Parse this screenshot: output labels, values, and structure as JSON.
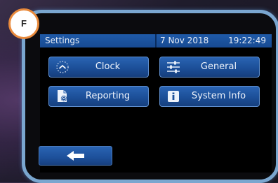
{
  "badge": {
    "label": "F"
  },
  "header": {
    "title": "Settings",
    "date": "7 Nov 2018",
    "time": "19:22:49"
  },
  "buttons": {
    "clock": {
      "label": "Clock",
      "icon": "clock-icon"
    },
    "general": {
      "label": "General",
      "icon": "sliders-icon"
    },
    "reporting": {
      "label": "Reporting",
      "icon": "report-gear-icon"
    },
    "system_info": {
      "label": "System Info",
      "icon": "info-icon"
    },
    "back": {
      "icon": "back-arrow-icon"
    }
  },
  "colors": {
    "header_bg": "#1f5aa8",
    "button_bg": "#1c4f98",
    "bezel_border": "#7aa6cf",
    "badge_border": "#e98a3c"
  }
}
